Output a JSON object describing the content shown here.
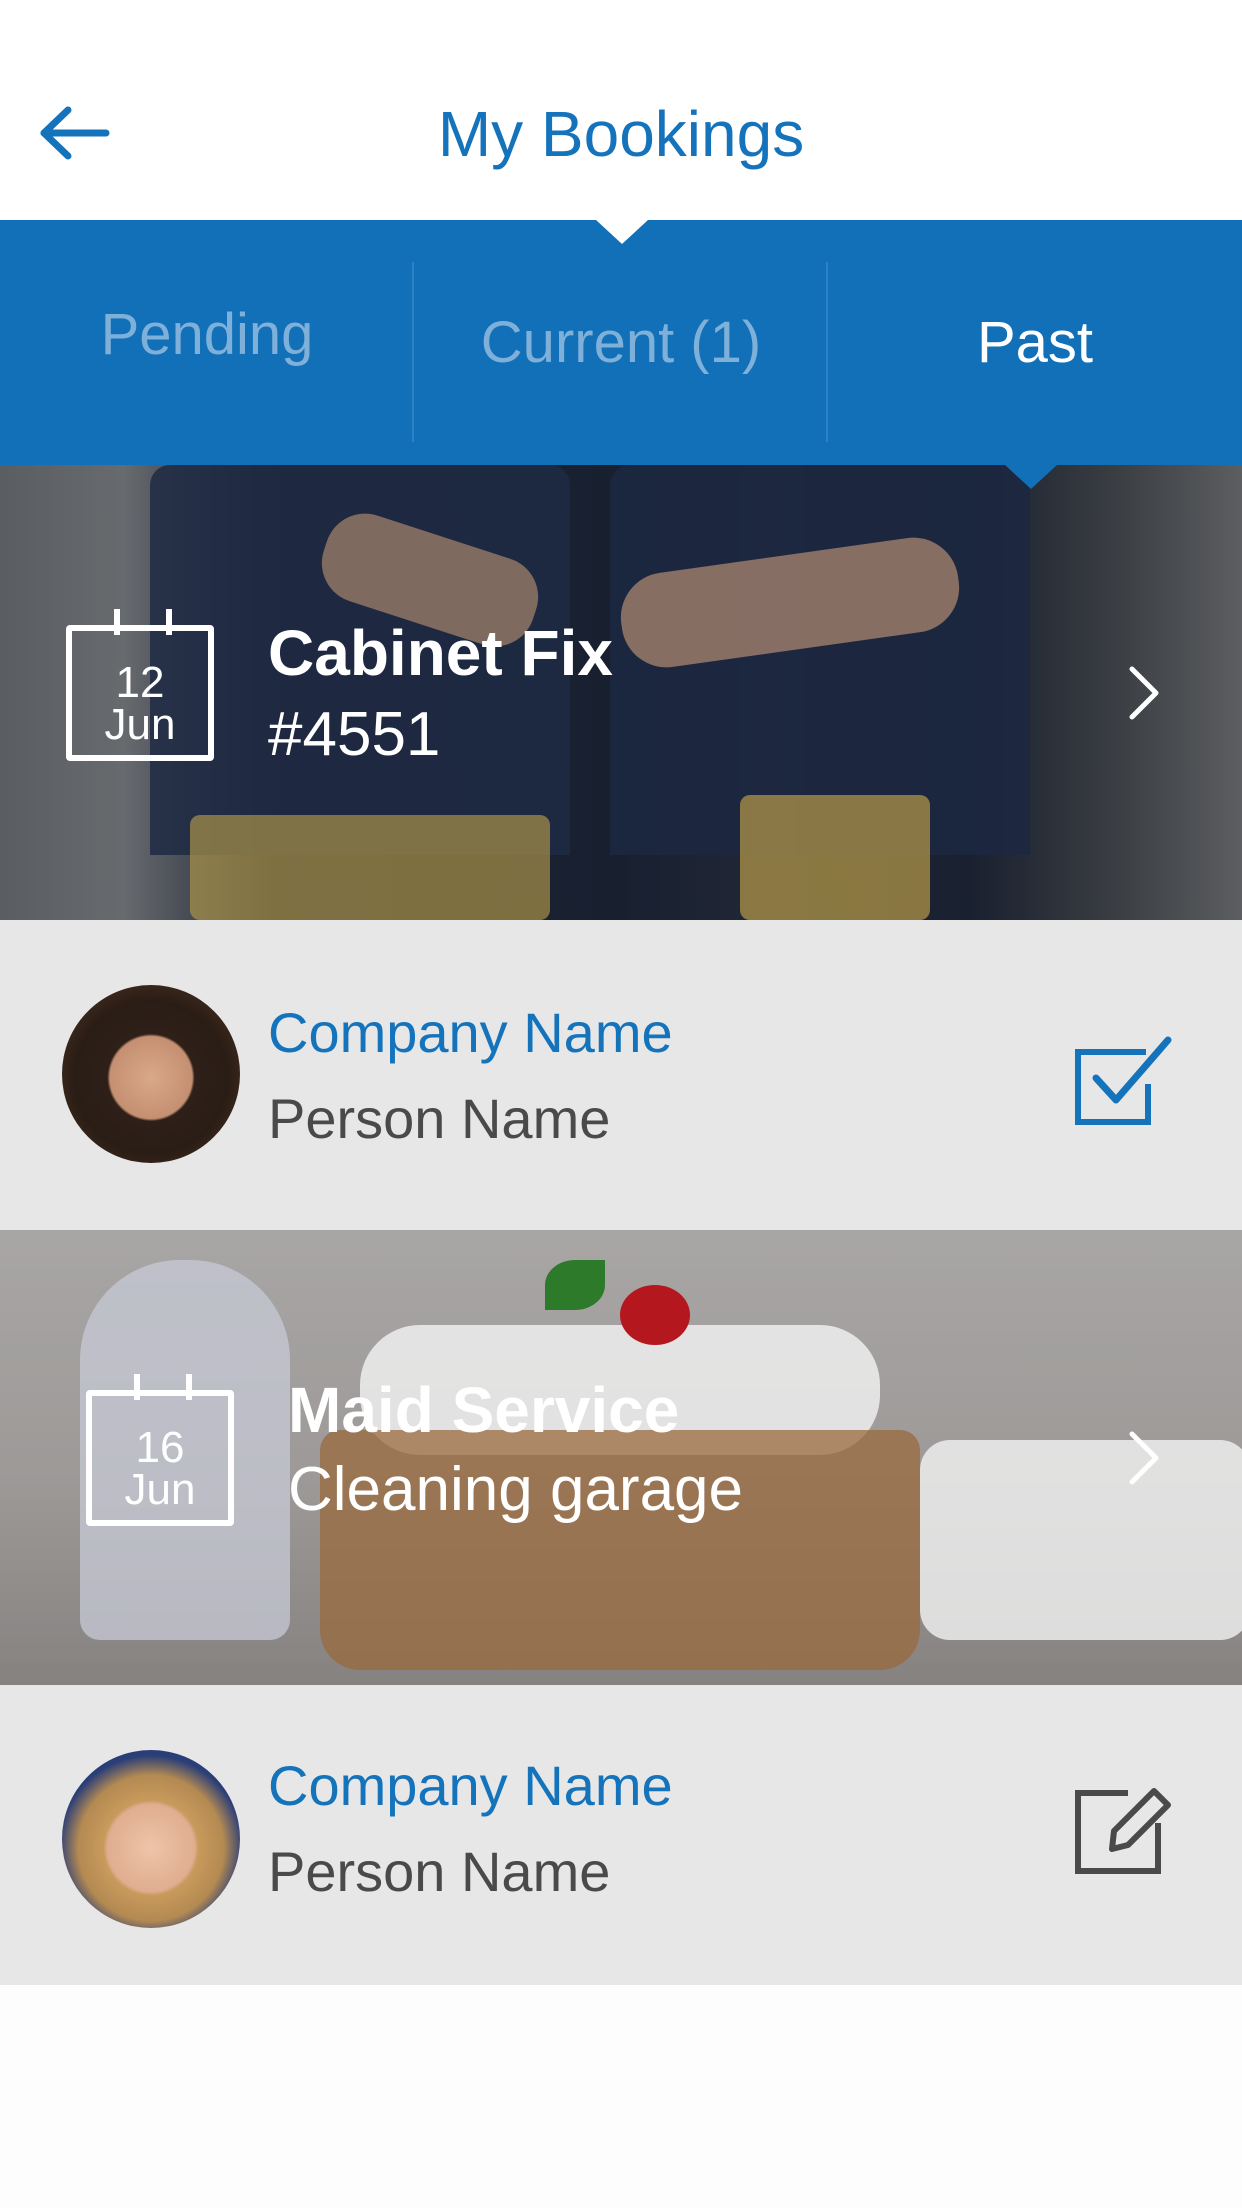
{
  "header": {
    "title": "My Bookings"
  },
  "tabs": [
    {
      "label": "Pending",
      "active": false
    },
    {
      "label": "Current (1)",
      "active": false
    },
    {
      "label": "Past",
      "active": true
    }
  ],
  "bookings": [
    {
      "date_day": "12",
      "date_month": "Jun",
      "title": "Cabinet Fix",
      "subtitle": "#4551",
      "company": "Company Name",
      "person": "Person Name",
      "action_icon": "checkbox-checked-icon"
    },
    {
      "date_day": "16",
      "date_month": "Jun",
      "title": "Maid Service",
      "subtitle": "Cleaning garage",
      "company": "Company Name",
      "person": "Person Name",
      "action_icon": "edit-icon"
    }
  ],
  "colors": {
    "accent": "#1473bb",
    "tab_bar": "#1170b8",
    "row_bg": "#e7e7e8"
  }
}
